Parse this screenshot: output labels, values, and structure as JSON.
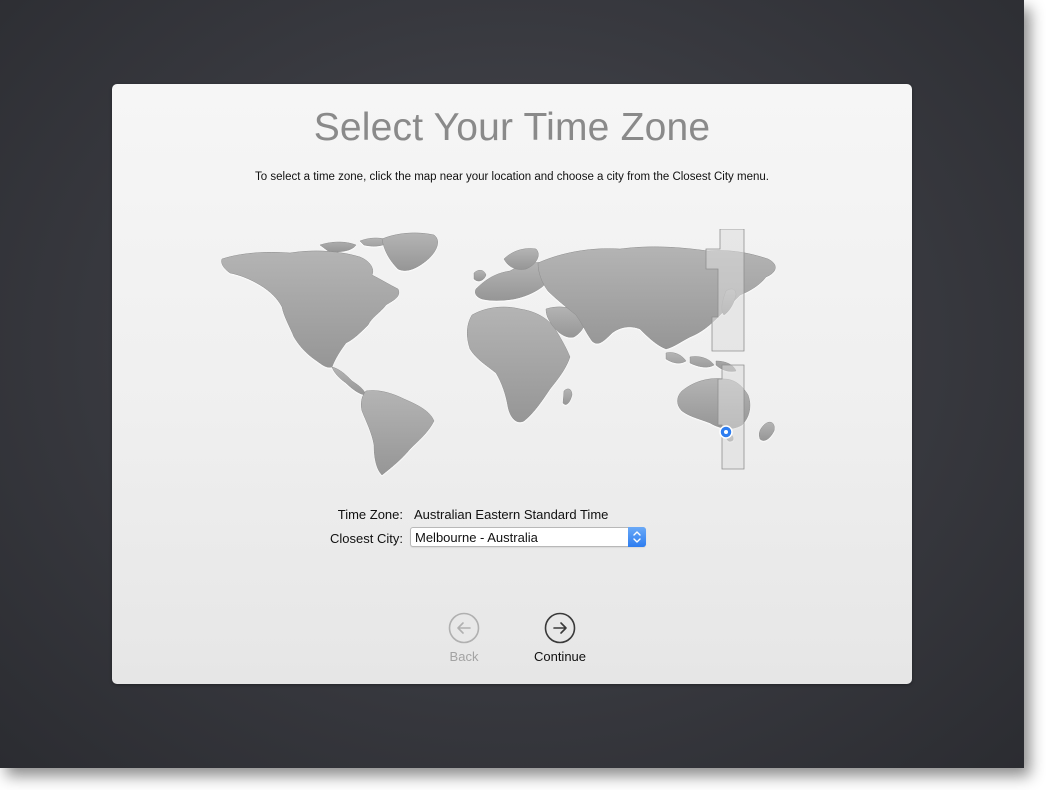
{
  "setup": {
    "title": "Select Your Time Zone",
    "instructions": "To select a time zone, click the map near your location and choose a city from the Closest City menu."
  },
  "time_zone": {
    "label": "Time Zone:",
    "value": "Australian Eastern Standard Time"
  },
  "closest_city": {
    "label": "Closest City:",
    "selected": "Melbourne - Australia"
  },
  "navigation": {
    "back_label": "Back",
    "continue_label": "Continue",
    "back_enabled": false
  },
  "colors": {
    "accent": "#2d7df0",
    "land": "#a2a2a2",
    "selected_zone": "#dcdcdc",
    "title_text": "#8a8a8a"
  },
  "icons": {
    "back": "arrow-left-circle-icon",
    "continue": "arrow-right-circle-icon",
    "popup": "chevron-up-down-icon",
    "location": "location-pin-icon"
  }
}
